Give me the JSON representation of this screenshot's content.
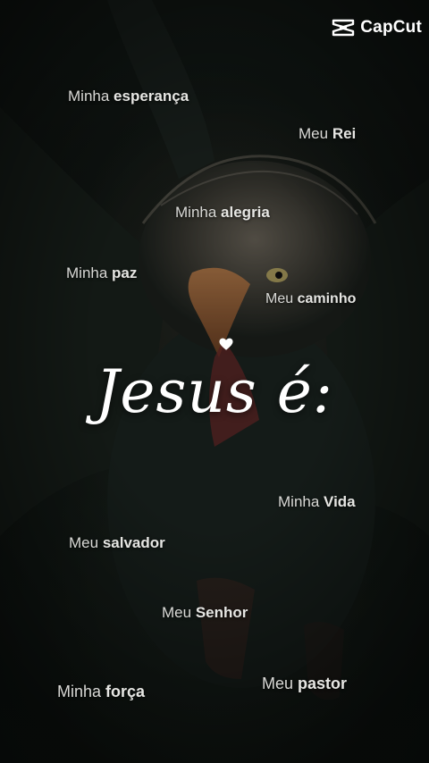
{
  "watermark": {
    "brand": "CapCut",
    "icon": "capcut-logo-icon"
  },
  "title": "Jesus é:",
  "heart_icon": "heart-icon",
  "phrases": [
    {
      "prefix": "Minha",
      "word": "esperança"
    },
    {
      "prefix": "Meu",
      "word": "Rei"
    },
    {
      "prefix": "Minha",
      "word": "alegria"
    },
    {
      "prefix": "Minha",
      "word": "paz"
    },
    {
      "prefix": "Meu",
      "word": "caminho"
    },
    {
      "prefix": "Minha",
      "word": "Vida"
    },
    {
      "prefix": "Meu",
      "word": "salvador"
    },
    {
      "prefix": "Meu",
      "word": "Senhor"
    },
    {
      "prefix": "Minha",
      "word": "força"
    },
    {
      "prefix": "Meu",
      "word": "pastor"
    }
  ]
}
